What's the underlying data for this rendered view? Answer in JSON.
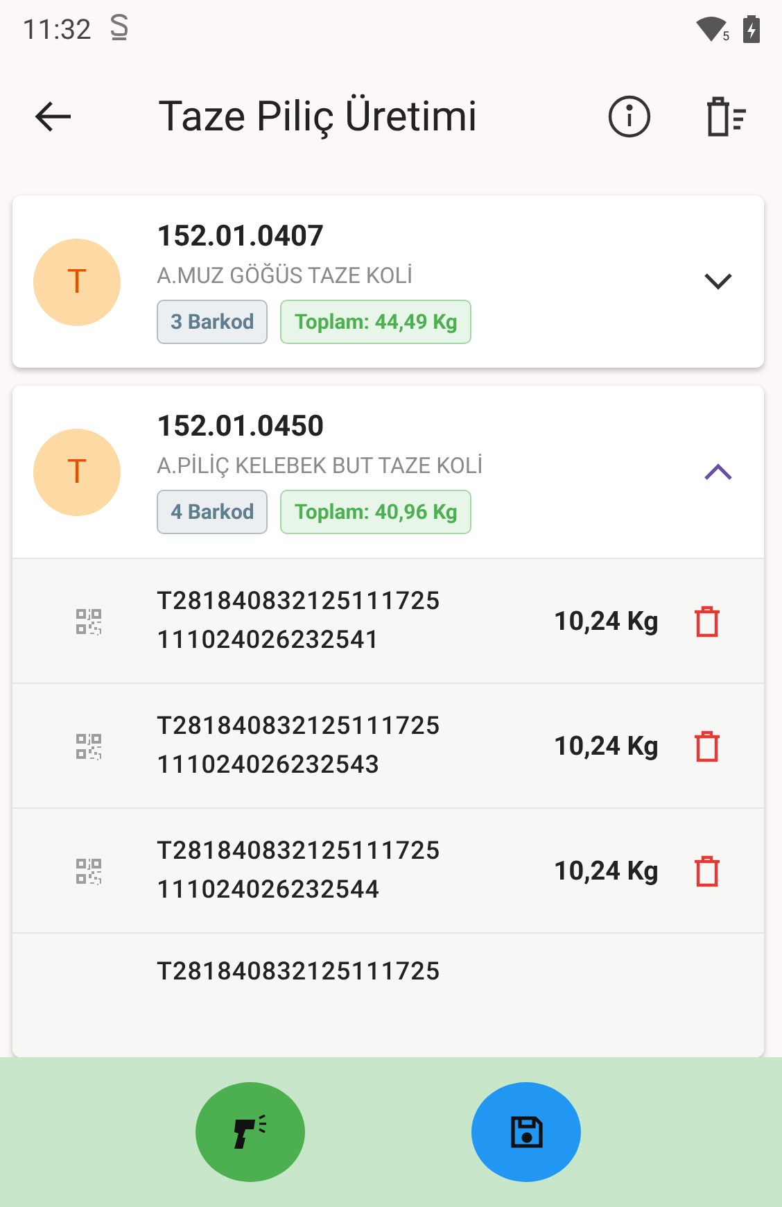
{
  "status_bar": {
    "time": "11:32",
    "signal_badge": "5"
  },
  "app_bar": {
    "title": "Taze Piliç Üretimi"
  },
  "products": [
    {
      "avatar": "T",
      "code": "152.01.0407",
      "name": "A.MUZ GÖĞÜS TAZE KOLİ",
      "barcode_count": "3 Barkod",
      "total": "Toplam: 44,49 Kg",
      "expanded": false
    },
    {
      "avatar": "T",
      "code": "152.01.0450",
      "name": "A.PİLİÇ KELEBEK BUT TAZE KOLİ",
      "barcode_count": "4 Barkod",
      "total": "Toplam: 40,96 Kg",
      "expanded": true,
      "items": [
        {
          "barcode_lines": [
            "T281840832125111725",
            "111024026232541"
          ],
          "weight": "10,24 Kg"
        },
        {
          "barcode_lines": [
            "T281840832125111725",
            "111024026232543"
          ],
          "weight": "10,24 Kg"
        },
        {
          "barcode_lines": [
            "T281840832125111725",
            "111024026232544"
          ],
          "weight": "10,24 Kg"
        },
        {
          "barcode_lines": [
            "T281840832125111725"
          ]
        }
      ]
    }
  ]
}
